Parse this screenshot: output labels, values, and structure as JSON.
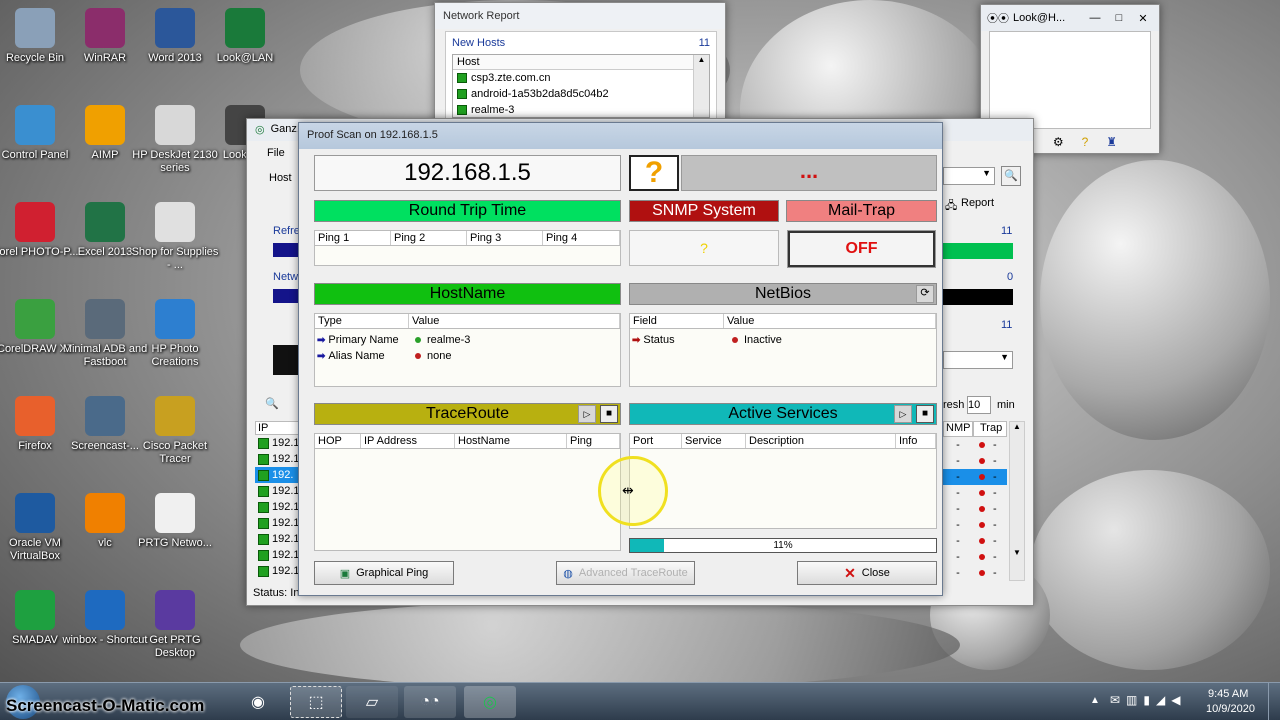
{
  "desktop_icons": [
    {
      "label": "Recycle Bin",
      "icon": "recycle-bin-icon",
      "color": "#8aa0b8"
    },
    {
      "label": "WinRAR",
      "icon": "winrar-icon",
      "color": "#8b2d6b"
    },
    {
      "label": "Word 2013",
      "icon": "word-icon",
      "color": "#2b579a"
    },
    {
      "label": "Look@LAN",
      "icon": "lookatlan-icon",
      "color": "#1a7a3a"
    },
    {
      "label": "Control Panel",
      "icon": "control-panel-icon",
      "color": "#3a8fd0"
    },
    {
      "label": "AIMP",
      "icon": "aimp-icon",
      "color": "#f0a000"
    },
    {
      "label": "HP DeskJet 2130 series",
      "icon": "printer-icon",
      "color": "#d8d8d8"
    },
    {
      "label": "Look@...",
      "icon": "lookatlan-icon",
      "color": "#444444"
    },
    {
      "label": "Corel PHOTO-P...",
      "icon": "corel-photo-icon",
      "color": "#d02030"
    },
    {
      "label": "Excel 2013",
      "icon": "excel-icon",
      "color": "#217346"
    },
    {
      "label": "Shop for Supplies - ...",
      "icon": "ink-icon",
      "color": "#e0e0e0"
    },
    {
      "label": "CorelDRAW X7",
      "icon": "coreldraw-icon",
      "color": "#3aa040"
    },
    {
      "label": "Minimal ADB and Fastboot",
      "icon": "adb-icon",
      "color": "#5a6a7a"
    },
    {
      "label": "HP Photo Creations",
      "icon": "hp-photo-icon",
      "color": "#2d7fd0"
    },
    {
      "label": "Firefox",
      "icon": "firefox-icon",
      "color": "#e8602c"
    },
    {
      "label": "Screencast-...",
      "icon": "screencast-icon",
      "color": "#4a6a8a"
    },
    {
      "label": "Cisco Packet Tracer",
      "icon": "cisco-icon",
      "color": "#c8a020"
    },
    {
      "label": "Oracle VM VirtualBox",
      "icon": "virtualbox-icon",
      "color": "#1e5aa0"
    },
    {
      "label": "vlc",
      "icon": "vlc-icon",
      "color": "#f08000"
    },
    {
      "label": "PRTG Netwo...",
      "icon": "prtg-icon",
      "color": "#f0f0f0"
    },
    {
      "label": "SMADAV",
      "icon": "smadav-icon",
      "color": "#1ea040"
    },
    {
      "label": "winbox - Shortcut",
      "icon": "winbox-icon",
      "color": "#1e6ac0"
    },
    {
      "label": "Get PRTG Desktop",
      "icon": "prtg-desktop-icon",
      "color": "#5a3aa0"
    }
  ],
  "network_report": {
    "title": "Network Report",
    "new_hosts_label": "New Hosts",
    "new_hosts_count": "11",
    "column": "Host",
    "hosts": [
      "csp3.zte.com.cn",
      "android-1a53b2da8d5c04b2",
      "realme-3"
    ]
  },
  "look_small": {
    "title": "Look@H..."
  },
  "main_window": {
    "title": "Ganz...",
    "menu_file": "File",
    "host_label": "Host",
    "refresh_label": "Refre",
    "network_label": "Netw",
    "report_label": "Report",
    "count_a": "11",
    "count_b": "0",
    "count_c": "11",
    "refresh_text": "resh",
    "refresh_value": "10",
    "refresh_unit": "min",
    "ip_col": "IP Addres",
    "snmp_col": "NMP",
    "trap_col": "Trap",
    "ip_rows": [
      "192.1",
      "192.1",
      "192.",
      "192.1",
      "192.1",
      "192.1",
      "192.1",
      "192.1",
      "192.1"
    ],
    "status": "Status: In"
  },
  "proof_scan": {
    "title": "Proof Scan on 192.168.1.5",
    "ip": "192.168.1.5",
    "question": "?",
    "dots": "...",
    "round_trip": "Round Trip Time",
    "ping_cols": [
      "Ping 1",
      "Ping 2",
      "Ping 3",
      "Ping 4"
    ],
    "snmp": "SNMP System",
    "snmp_value": "?",
    "mail_trap": "Mail-Trap",
    "off": "OFF",
    "hostname": "HostName",
    "hostname_cols": [
      "Type",
      "Value"
    ],
    "hostname_rows": [
      {
        "type": "Primary Name",
        "value": "realme-3",
        "status_color": "#2aa02a"
      },
      {
        "type": "Alias Name",
        "value": "none",
        "status_color": "#c02020"
      }
    ],
    "netbios": "NetBios",
    "netbios_cols": [
      "Field",
      "Value"
    ],
    "netbios_rows": [
      {
        "field": "Status",
        "value": "Inactive",
        "status_color": "#c02020"
      }
    ],
    "traceroute": "TraceRoute",
    "trace_cols": [
      "HOP",
      "IP Address",
      "HostName",
      "Ping"
    ],
    "active_services": "Active Services",
    "service_cols": [
      "Port",
      "Service",
      "Description",
      "Info"
    ],
    "progress_text": "11%",
    "progress_value": 0.11,
    "graphical_ping": "Graphical Ping",
    "advanced_traceroute": "Advanced TraceRoute",
    "close": "Close",
    "colors": {
      "green": "#00e060",
      "dark_red": "#b01010",
      "salmon": "#f08080",
      "olive": "#b8b010",
      "teal": "#10b8b8",
      "gray": "#b0b0b0"
    }
  },
  "taskbar": {
    "clock_time": "9:45 AM",
    "clock_date": "10/9/2020",
    "watermark": "Screencast-O-Matic.com"
  }
}
